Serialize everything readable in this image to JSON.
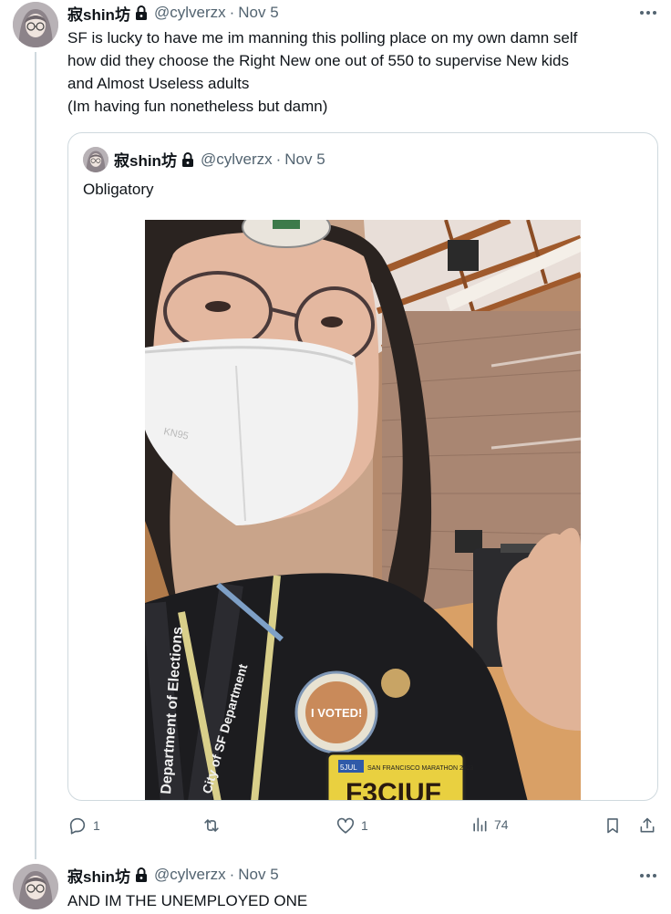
{
  "tweet": {
    "name": "寂shin坊",
    "handle": "@cylverzx",
    "separator": "·",
    "date": "Nov 5",
    "text_lines": [
      "SF is lucky to have me im manning this polling place on my own damn self",
      "how did they choose the Right New one out of 550 to supervise New kids",
      "and Almost Useless adults",
      "(Im having fun nonetheless but damn)"
    ]
  },
  "quote": {
    "name": "寂shin坊",
    "handle": "@cylverzx",
    "separator": "·",
    "date": "Nov 5",
    "text": "Obligatory",
    "photo": {
      "stickers": {
        "voted": "I VOTED!",
        "license": "SAN FRANCISCO MARATHON 2023",
        "plate": "5JUL",
        "plate_big": "F3CIUF",
        "mask": "KN95",
        "lanyard": "Department of Elections",
        "lanyard2": "City of SF Department"
      }
    }
  },
  "actions": {
    "replies": "1",
    "retweets": "",
    "likes": "1",
    "views": "74"
  },
  "reply": {
    "name": "寂shin坊",
    "handle": "@cylverzx",
    "separator": "·",
    "date": "Nov 5",
    "text": "AND IM THE UNEMPLOYED ONE"
  },
  "colors": {
    "text": "#0f1419",
    "muted": "#536471",
    "border": "#cfd9de"
  }
}
